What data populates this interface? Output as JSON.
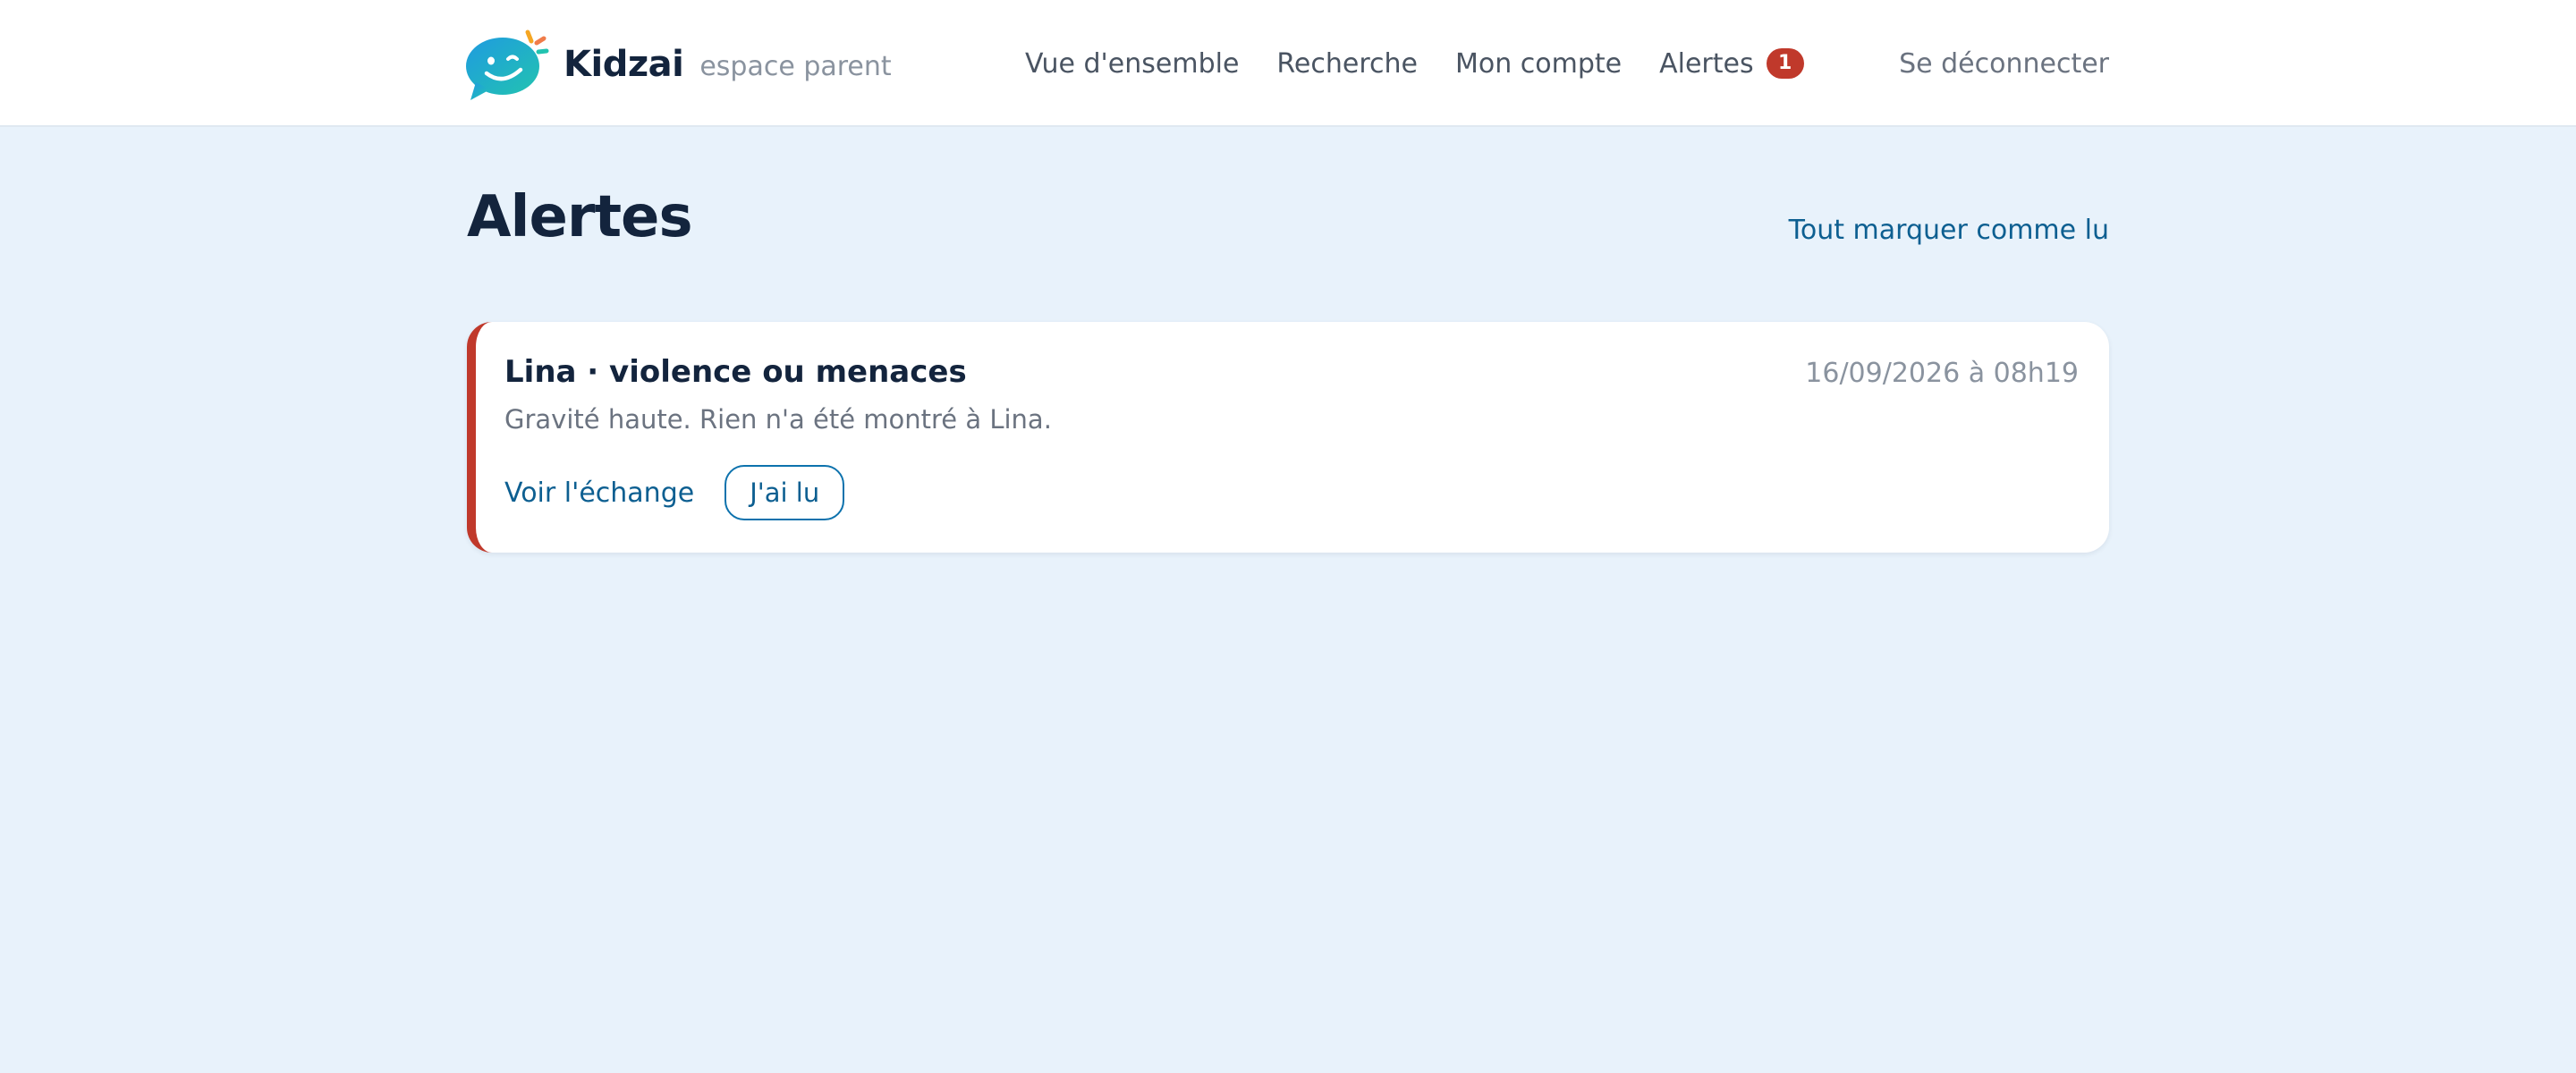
{
  "header": {
    "brand_name": "Kidzai",
    "brand_subtitle": "espace parent",
    "logo_icon": "smiling-speech-bubble-icon",
    "nav": [
      {
        "label": "Vue d'ensemble"
      },
      {
        "label": "Recherche"
      },
      {
        "label": "Mon compte"
      },
      {
        "label": "Alertes",
        "badge": "1"
      }
    ],
    "logout_label": "Se déconnecter"
  },
  "page": {
    "title": "Alertes",
    "mark_all_read": "Tout marquer comme lu"
  },
  "alerts": [
    {
      "title": "Lina · violence ou menaces",
      "timestamp": "16/09/2026 à 08h19",
      "description": "Gravité haute. Rien n'a été montré à Lina.",
      "view_label": "Voir l'échange",
      "read_label": "J'ai lu",
      "severity_color": "#c0392b"
    }
  ],
  "colors": {
    "background": "#e8f2fb",
    "accent": "#0d5f91",
    "alert_red": "#c0392b",
    "logo_blue": "#1f9be0",
    "logo_teal": "#22c3b0",
    "logo_orange": "#f5a623"
  }
}
